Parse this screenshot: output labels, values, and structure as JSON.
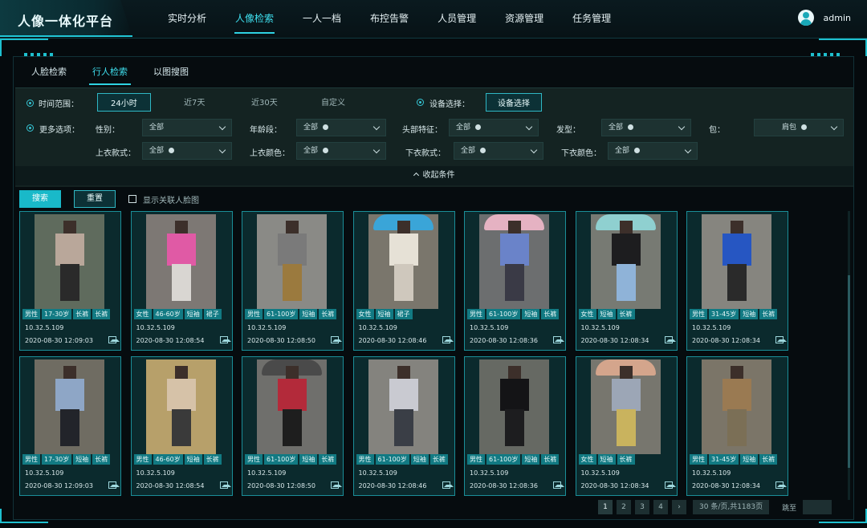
{
  "app": {
    "title": "人像一体化平台",
    "username": "admin"
  },
  "nav": [
    "实时分析",
    "人像检索",
    "一人一档",
    "布控告警",
    "人员管理",
    "资源管理",
    "任务管理"
  ],
  "tabs": [
    "人脸检索",
    "行人检索",
    "以图搜图"
  ],
  "filters": {
    "time_range_label": "时间范围：",
    "time_options": [
      "24小时",
      "近7天",
      "近30天",
      "自定义"
    ],
    "device_label": "设备选择：",
    "device_button": "设备选择",
    "more_label": "更多选项：",
    "fields": [
      {
        "label": "性别：",
        "value": "全部"
      },
      {
        "label": "年龄段：",
        "value": "全部"
      },
      {
        "label": "头部特征：",
        "value": "全部"
      },
      {
        "label": "发型：",
        "value": "全部"
      },
      {
        "label": "包：",
        "value": "肩包"
      },
      {
        "label": "上衣款式：",
        "value": "全部"
      },
      {
        "label": "上衣颜色：",
        "value": "全部"
      },
      {
        "label": "下衣款式：",
        "value": "全部"
      },
      {
        "label": "下衣颜色：",
        "value": "全部"
      }
    ],
    "collapse_label": "收起条件"
  },
  "actions": {
    "search": "搜索",
    "reset": "重置",
    "show_face": "显示关联人脸图"
  },
  "results": [
    {
      "tags": [
        "男性",
        "17-30岁",
        "长裤",
        "长裤"
      ],
      "ip": "10.32.5.109",
      "time": "2020-08-30 12:09:03"
    },
    {
      "tags": [
        "女性",
        "46-60岁",
        "短袖",
        "裙子"
      ],
      "ip": "10.32.5.109",
      "time": "2020-08-30 12:08:54"
    },
    {
      "tags": [
        "男性",
        "61-100岁",
        "短袖",
        "长裤"
      ],
      "ip": "10.32.5.109",
      "time": "2020-08-30 12:08:50"
    },
    {
      "tags": [
        "女性",
        "短袖",
        "裙子"
      ],
      "ip": "10.32.5.109",
      "time": "2020-08-30 12:08:46"
    },
    {
      "tags": [
        "男性",
        "61-100岁",
        "短袖",
        "长裤"
      ],
      "ip": "10.32.5.109",
      "time": "2020-08-30 12:08:36"
    },
    {
      "tags": [
        "女性",
        "短袖",
        "长裤"
      ],
      "ip": "10.32.5.109",
      "time": "2020-08-30 12:08:34"
    },
    {
      "tags": [
        "男性",
        "31-45岁",
        "短袖",
        "长裤"
      ],
      "ip": "10.32.5.109",
      "time": "2020-08-30 12:08:34"
    },
    {
      "tags": [
        "男性",
        "17-30岁",
        "短袖",
        "长裤"
      ],
      "ip": "10.32.5.109",
      "time": "2020-08-30 12:09:03"
    },
    {
      "tags": [
        "男性",
        "46-60岁",
        "短袖",
        "长裤"
      ],
      "ip": "10.32.5.109",
      "time": "2020-08-30 12:08:54"
    },
    {
      "tags": [
        "男性",
        "61-100岁",
        "短袖",
        "长裤"
      ],
      "ip": "10.32.5.109",
      "time": "2020-08-30 12:08:50"
    },
    {
      "tags": [
        "男性",
        "61-100岁",
        "短袖",
        "长裤"
      ],
      "ip": "10.32.5.109",
      "time": "2020-08-30 12:08:46"
    },
    {
      "tags": [
        "男性",
        "61-100岁",
        "短袖",
        "长裤"
      ],
      "ip": "10.32.5.109",
      "time": "2020-08-30 12:08:36"
    },
    {
      "tags": [
        "女性",
        "短袖",
        "长裤"
      ],
      "ip": "10.32.5.109",
      "time": "2020-08-30 12:08:34"
    },
    {
      "tags": [
        "男性",
        "31-45岁",
        "短袖",
        "长裤"
      ],
      "ip": "10.32.5.109",
      "time": "2020-08-30 12:08:34"
    }
  ],
  "pager": {
    "pages": [
      "1",
      "2",
      "3",
      "4"
    ],
    "next": "›",
    "size_info": "30 条/页,共1183页",
    "goto_label": "跳至"
  },
  "colors": {
    "accent": "#2ed2e2",
    "card_border": "#1a8e98",
    "tag_bg": "#127a83"
  }
}
